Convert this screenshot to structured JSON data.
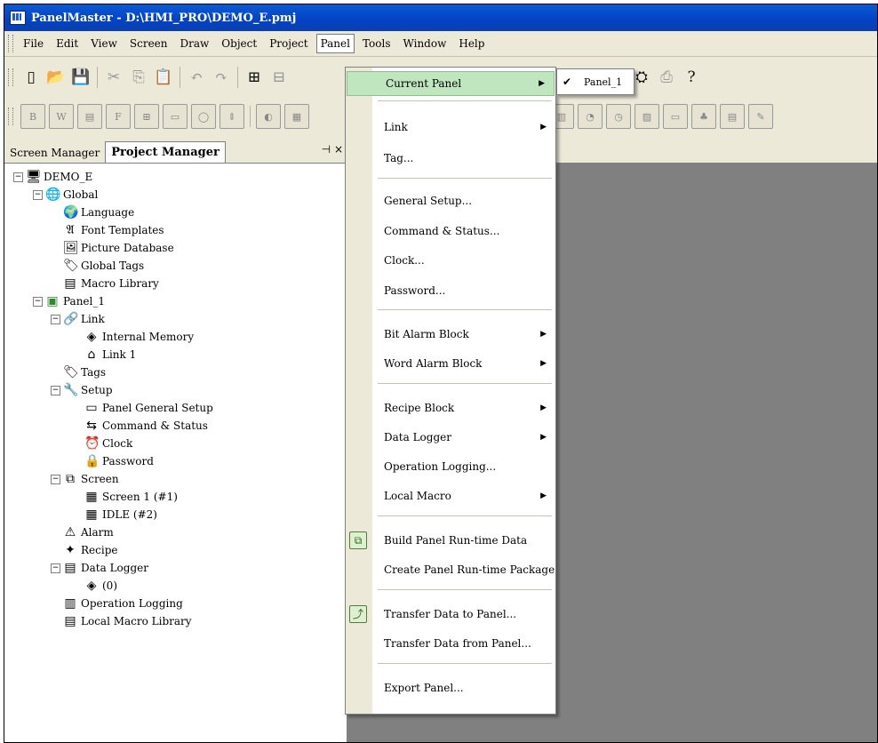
{
  "window": {
    "title": "PanelMaster - D:\\HMI_PRO\\DEMO_E.pmj"
  },
  "menubar": [
    {
      "label": "File"
    },
    {
      "label": "Edit"
    },
    {
      "label": "View"
    },
    {
      "label": "Screen"
    },
    {
      "label": "Draw"
    },
    {
      "label": "Object"
    },
    {
      "label": "Project"
    },
    {
      "label": "Panel"
    },
    {
      "label": "Tools"
    },
    {
      "label": "Window"
    },
    {
      "label": "Help"
    }
  ],
  "toolbar": {
    "zoom_hint": "..."
  },
  "left_pane": {
    "tabs": [
      {
        "label": "Screen Manager"
      },
      {
        "label": "Project Manager"
      }
    ],
    "controls": "⊣ ×"
  },
  "tree": [
    {
      "label": "DEMO_E"
    },
    {
      "label": "Global"
    },
    {
      "label": "Language"
    },
    {
      "label": "Font Templates"
    },
    {
      "label": "Picture Database"
    },
    {
      "label": "Global Tags"
    },
    {
      "label": "Macro Library"
    },
    {
      "label": "Panel_1"
    },
    {
      "label": "Link"
    },
    {
      "label": "Internal Memory"
    },
    {
      "label": "Link 1"
    },
    {
      "label": "Tags"
    },
    {
      "label": "Setup"
    },
    {
      "label": "Panel General Setup"
    },
    {
      "label": "Command & Status"
    },
    {
      "label": "Clock"
    },
    {
      "label": "Password"
    },
    {
      "label": "Screen"
    },
    {
      "label": "Screen 1 (#1)"
    },
    {
      "label": "IDLE (#2)"
    },
    {
      "label": "Alarm"
    },
    {
      "label": "Recipe"
    },
    {
      "label": "Data Logger"
    },
    {
      "label": "(0)"
    },
    {
      "label": "Operation Logging"
    },
    {
      "label": "Local Macro Library"
    }
  ],
  "panel_menu": {
    "items": [
      {
        "label": "Current Panel"
      },
      {
        "label": "Link"
      },
      {
        "label": "Tag..."
      },
      {
        "label": "General Setup..."
      },
      {
        "label": "Command & Status..."
      },
      {
        "label": "Clock..."
      },
      {
        "label": "Password..."
      },
      {
        "label": "Bit Alarm Block"
      },
      {
        "label": "Word Alarm Block"
      },
      {
        "label": "Recipe Block"
      },
      {
        "label": "Data Logger"
      },
      {
        "label": "Operation Logging..."
      },
      {
        "label": "Local Macro"
      },
      {
        "label": "Build Panel Run-time Data"
      },
      {
        "label": "Create Panel Run-time Package"
      },
      {
        "label": "Transfer Data to Panel..."
      },
      {
        "label": "Transfer Data from Panel..."
      },
      {
        "label": "Export Panel..."
      }
    ]
  },
  "current_panel_submenu": {
    "items": [
      {
        "label": "Panel_1",
        "checked": true
      }
    ]
  },
  "colors": {
    "title_bar": "#0343c5",
    "menu_highlight": "#bfe6bf",
    "workspace": "#808080",
    "chrome": "#ece9d8"
  }
}
